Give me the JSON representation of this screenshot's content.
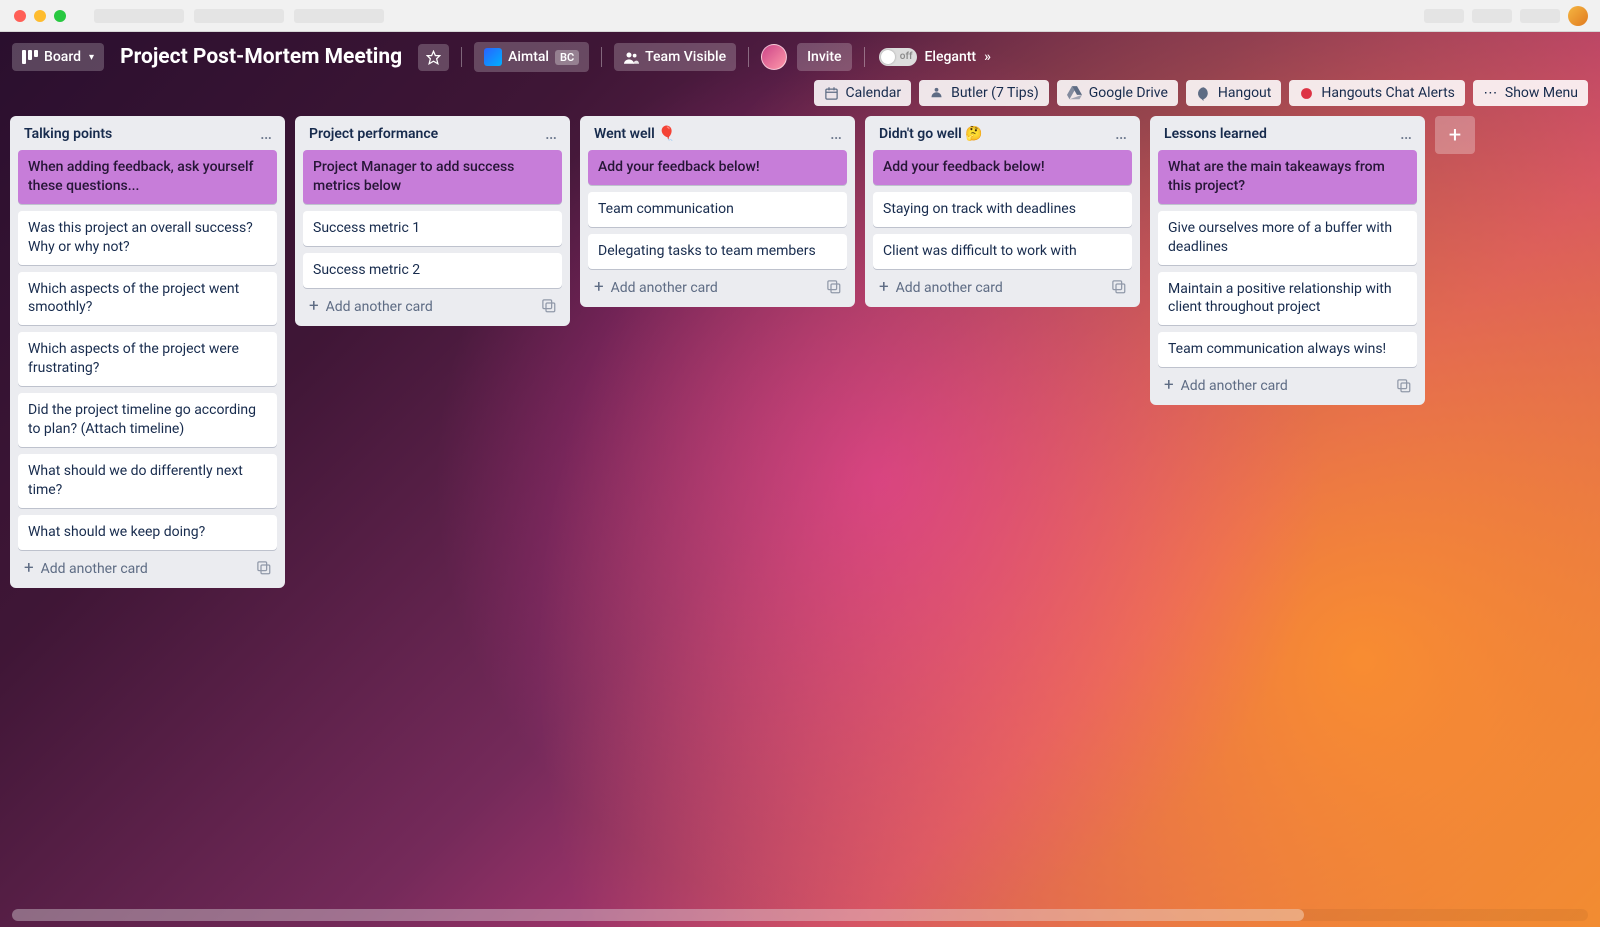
{
  "header": {
    "view_label": "Board",
    "board_title": "Project Post-Mortem Meeting",
    "team_name": "Aimtal",
    "team_badge": "BC",
    "visibility": "Team Visible",
    "invite": "Invite",
    "toggle_off": "off",
    "elegantt": "Elegantt",
    "elegantt_arrow": "»"
  },
  "powerups": [
    {
      "id": "calendar",
      "label": "Calendar",
      "icon": "calendar"
    },
    {
      "id": "butler",
      "label": "Butler (7 Tips)",
      "icon": "butler"
    },
    {
      "id": "google-drive",
      "label": "Google Drive",
      "icon": "drive"
    },
    {
      "id": "hangout",
      "label": "Hangout",
      "icon": "hangout"
    },
    {
      "id": "hangouts-chat",
      "label": "Hangouts Chat Alerts",
      "icon": "chat"
    }
  ],
  "show_menu": "Show Menu",
  "add_card_label": "Add another card",
  "lists": [
    {
      "id": "talking-points",
      "title": "Talking points",
      "emoji": "",
      "cards": [
        {
          "text": "When adding feedback, ask yourself these questions...",
          "purple": true
        },
        {
          "text": "Was this project an overall success? Why or why not?"
        },
        {
          "text": "Which aspects of the project went smoothly?"
        },
        {
          "text": "Which aspects of the project were frustrating?"
        },
        {
          "text": "Did the project timeline go according to plan? (Attach timeline)"
        },
        {
          "text": "What should we do differently next time?"
        },
        {
          "text": "What should we keep doing?"
        }
      ]
    },
    {
      "id": "project-performance",
      "title": "Project performance",
      "emoji": "",
      "cards": [
        {
          "text": "Project Manager to add success metrics below",
          "purple": true
        },
        {
          "text": "Success metric 1"
        },
        {
          "text": "Success metric 2"
        }
      ]
    },
    {
      "id": "went-well",
      "title": "Went well",
      "emoji": "🎈",
      "cards": [
        {
          "text": "Add your feedback below!",
          "purple": true
        },
        {
          "text": "Team communication"
        },
        {
          "text": "Delegating tasks to team members"
        }
      ]
    },
    {
      "id": "didnt-go-well",
      "title": "Didn't go well",
      "emoji": "🤔",
      "cards": [
        {
          "text": "Add your feedback below!",
          "purple": true
        },
        {
          "text": "Staying on track with deadlines"
        },
        {
          "text": "Client was difficult to work with"
        }
      ]
    },
    {
      "id": "lessons-learned",
      "title": "Lessons learned",
      "emoji": "",
      "cards": [
        {
          "text": "What are the main takeaways from this project?",
          "purple": true
        },
        {
          "text": "Give ourselves more of a buffer with deadlines"
        },
        {
          "text": "Maintain a positive relationship with client throughout project"
        },
        {
          "text": "Team communication always wins!"
        }
      ]
    }
  ]
}
